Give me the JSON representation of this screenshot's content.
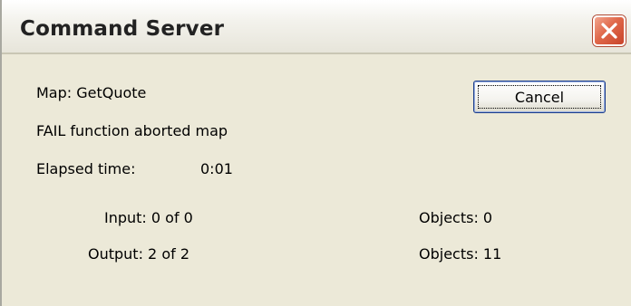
{
  "window": {
    "title": "Command Server",
    "close_icon": "close-x-icon",
    "close_color": "#d9583b"
  },
  "status": {
    "map": "Map: GetQuote",
    "message": "FAIL function aborted map",
    "elapsed_label": "Elapsed time:",
    "elapsed_value": "0:01"
  },
  "stats": {
    "input": "Input: 0 of 0",
    "output": "Output: 2 of 2",
    "input_objects": "Objects: 0",
    "output_objects": "Objects: 11"
  },
  "buttons": {
    "cancel_label": "Cancel"
  }
}
